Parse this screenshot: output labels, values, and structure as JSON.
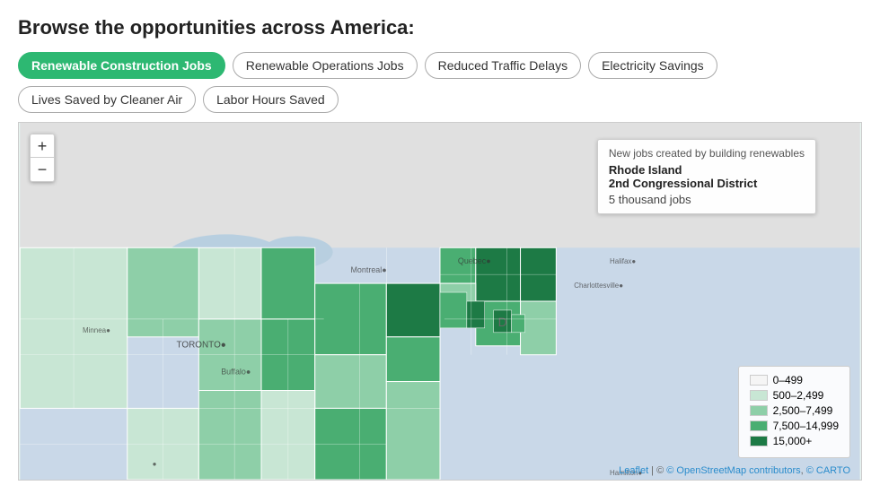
{
  "page": {
    "title": "Browse the opportunities across America:"
  },
  "tabs": [
    {
      "id": "renewable-construction-jobs",
      "label": "Renewable Construction Jobs",
      "active": true
    },
    {
      "id": "renewable-operations-jobs",
      "label": "Renewable Operations Jobs",
      "active": false
    },
    {
      "id": "reduced-traffic-delays",
      "label": "Reduced Traffic Delays",
      "active": false
    },
    {
      "id": "electricity-savings",
      "label": "Electricity Savings",
      "active": false
    },
    {
      "id": "lives-saved-by-cleaner-air",
      "label": "Lives Saved by Cleaner Air",
      "active": false
    },
    {
      "id": "labor-hours-saved",
      "label": "Labor Hours Saved",
      "active": false
    }
  ],
  "zoom": {
    "plus": "+",
    "minus": "−"
  },
  "tooltip": {
    "header": "New jobs created by building renewables",
    "region": "Rhode Island",
    "district": "2nd Congressional District",
    "value": "5 thousand jobs"
  },
  "legend": {
    "title": "",
    "items": [
      {
        "label": "0–499",
        "color": "#f5f5f5"
      },
      {
        "label": "500–2,499",
        "color": "#c8e6d4"
      },
      {
        "label": "2,500–7,499",
        "color": "#8ecfa8"
      },
      {
        "label": "7,500–14,999",
        "color": "#4aae72"
      },
      {
        "label": "15,000+",
        "color": "#1d7a45"
      }
    ]
  },
  "attribution": {
    "leaflet": "Leaflet",
    "openstreetmap": "© OpenStreetMap contributors",
    "carto": "© CARTO"
  }
}
